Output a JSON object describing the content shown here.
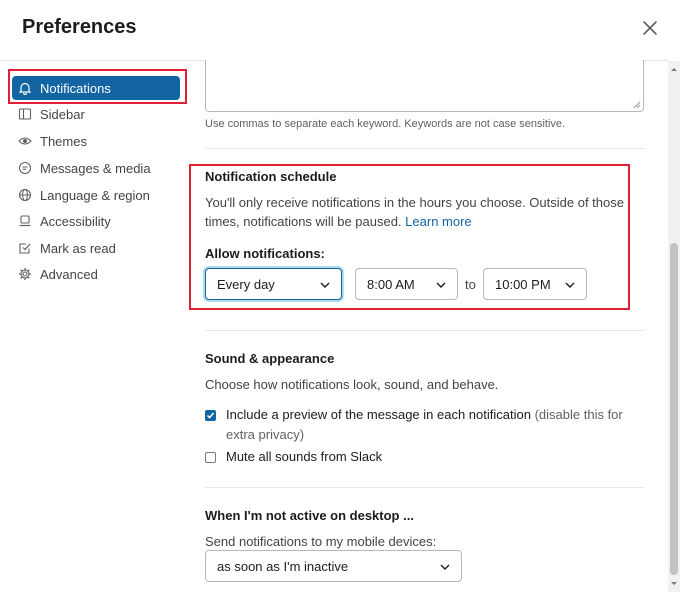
{
  "dialog": {
    "title": "Preferences"
  },
  "sidebar": {
    "items": [
      {
        "label": "Notifications",
        "icon": "bell-icon"
      },
      {
        "label": "Sidebar",
        "icon": "sidebar-icon"
      },
      {
        "label": "Themes",
        "icon": "eye-icon"
      },
      {
        "label": "Messages & media",
        "icon": "message-icon"
      },
      {
        "label": "Language & region",
        "icon": "globe-icon"
      },
      {
        "label": "Accessibility",
        "icon": "laptop-icon"
      },
      {
        "label": "Mark as read",
        "icon": "check-square-icon"
      },
      {
        "label": "Advanced",
        "icon": "gear-icon"
      }
    ],
    "active": "Notifications"
  },
  "keywords": {
    "hint": "Use commas to separate each keyword. Keywords are not case sensitive."
  },
  "schedule": {
    "title": "Notification schedule",
    "description_line1": "You'll only receive notifications in the hours you choose. Outside of those",
    "description_line2": "times, notifications will be paused.",
    "learn_more": "Learn more",
    "allow_label": "Allow notifications:",
    "days_value": "Every day",
    "start_value": "8:00 AM",
    "to_label": "to",
    "end_value": "10:00 PM"
  },
  "sound": {
    "title": "Sound & appearance",
    "description": "Choose how notifications look, sound, and behave.",
    "preview_line1": "Include a preview of the message in each notification",
    "preview_note": "(disable this for",
    "preview_line2": "extra privacy)",
    "preview_checked": true,
    "mute_label": "Mute all sounds from Slack",
    "mute_checked": false
  },
  "inactive": {
    "title": "When I'm not active on desktop ...",
    "send_label": "Send notifications to my mobile devices:",
    "send_value": "as soon as I'm inactive"
  },
  "colors": {
    "accent": "#1264a3",
    "highlight": "#e01e34"
  }
}
